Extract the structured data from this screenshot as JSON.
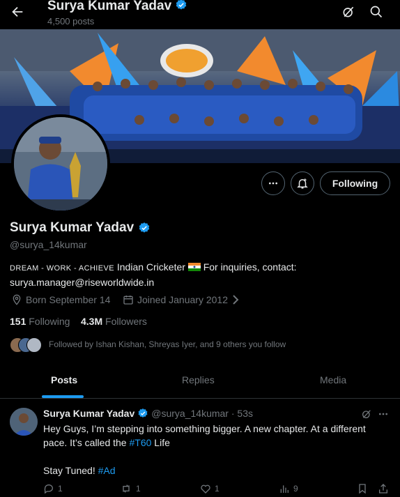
{
  "header": {
    "title": "Surya Kumar Yadav",
    "posts_count": "4,500 posts"
  },
  "profile": {
    "name": "Surya Kumar Yadav",
    "handle": "@surya_14kumar",
    "bio_caps": "DREAM - WORK - ACHIEVE",
    "bio_text": "Indian Cricketer",
    "bio_after_flag": "For inquiries, contact:",
    "bio_email": "surya.manager@riseworldwide.in",
    "born": "Born September 14",
    "joined": "Joined January 2012",
    "following_count": "151",
    "following_label": "Following",
    "followers_count": "4.3M",
    "followers_label": "Followers",
    "followed_by": "Followed by Ishan Kishan, Shreyas Iyer, and 9 others you follow",
    "follow_button": "Following"
  },
  "tabs": [
    {
      "label": "Posts",
      "active": true
    },
    {
      "label": "Replies",
      "active": false
    },
    {
      "label": "Media",
      "active": false
    }
  ],
  "post": {
    "author": "Surya Kumar Yadav",
    "handle_time": "@surya_14kumar · 53s",
    "line1": "Hey Guys, I’m stepping into something bigger. A new chapter. At a different",
    "line2_pre": "pace. It’s called the ",
    "line2_tag": "#T60",
    "line2_post": " Life",
    "line3_pre": "Stay Tuned! ",
    "line3_tag": "#Ad",
    "replies": "1",
    "reposts": "1",
    "likes": "1",
    "views": "9"
  },
  "colors": {
    "accent": "#1d9bf0",
    "verified": "#1d9bf0",
    "background": "#000000",
    "muted": "#71767b"
  },
  "icons": [
    "back-arrow-icon",
    "grok-icon",
    "search-icon",
    "more-icon",
    "notification-bell-icon",
    "verified-badge-icon",
    "location-icon",
    "calendar-icon",
    "chevron-right-icon",
    "reply-icon",
    "repost-icon",
    "like-icon",
    "views-icon",
    "bookmark-icon",
    "share-icon"
  ]
}
